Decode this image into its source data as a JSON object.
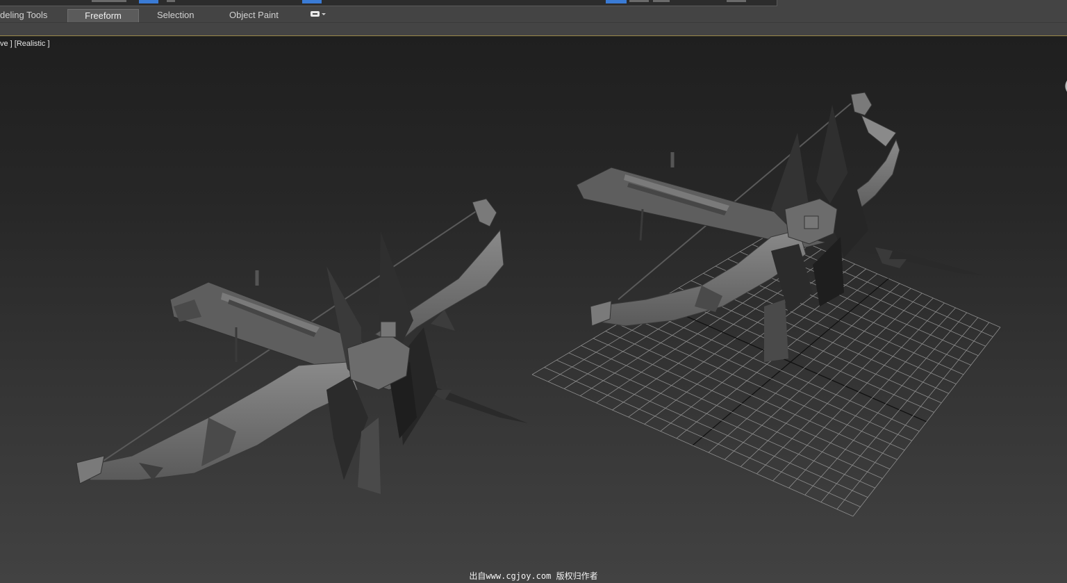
{
  "ribbon": {
    "tabs": [
      {
        "label": "deling Tools",
        "active": false
      },
      {
        "label": "Freeform",
        "active": true
      },
      {
        "label": "Selection",
        "active": false
      },
      {
        "label": "Object Paint",
        "active": false
      }
    ],
    "options_icon": "display-options-icon"
  },
  "viewport": {
    "label": "ve ] [Realistic ]",
    "viewcube_icon": "viewcube-icon",
    "grid_icon": "home-grid"
  },
  "objects": [
    {
      "name": "crossbow-model-left",
      "color": "#6e6e6e"
    },
    {
      "name": "crossbow-model-right",
      "color": "#6e6e6e"
    }
  ],
  "watermark": "出自www.cgjoy.com 版权归作者",
  "colors": {
    "accent": "#3a7bd5",
    "viewport_border": "#9a8a4a",
    "ribbon_bg": "#444444"
  }
}
